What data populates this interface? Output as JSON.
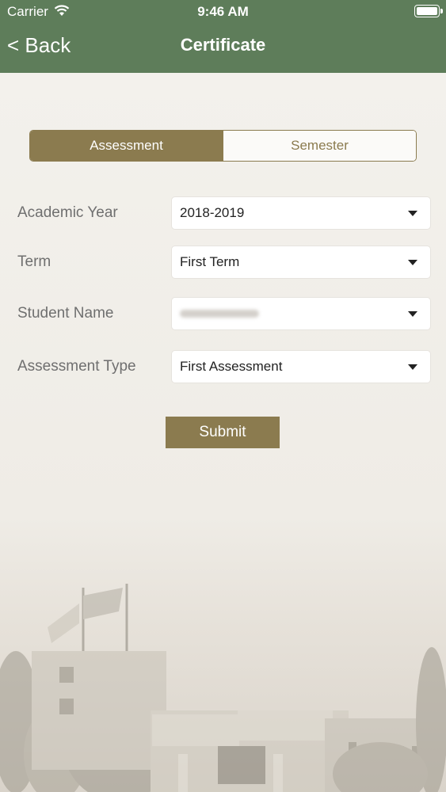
{
  "status_bar": {
    "carrier": "Carrier",
    "time": "9:46 AM"
  },
  "nav": {
    "back_label": "< Back",
    "title": "Certificate"
  },
  "tabs": [
    {
      "label": "Assessment",
      "selected": true
    },
    {
      "label": "Semester",
      "selected": false
    }
  ],
  "form": {
    "academic_year": {
      "label": "Academic Year",
      "value": "2018-2019"
    },
    "term": {
      "label": "Term",
      "value": "First Term"
    },
    "student_name": {
      "label": "Student Name",
      "value": ""
    },
    "assessment_type": {
      "label": "Assessment Type",
      "value": "First Assessment"
    }
  },
  "submit_label": "Submit",
  "colors": {
    "header": "#5e7d5a",
    "accent": "#8b7b4f",
    "background": "#eeebe5"
  },
  "icons": [
    "wifi-icon",
    "battery-icon",
    "dropdown-arrow-icon"
  ]
}
